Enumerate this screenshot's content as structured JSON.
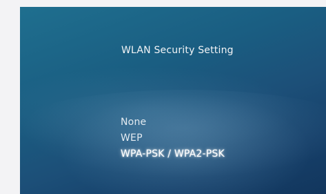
{
  "dialog": {
    "title": "WLAN Security Setting"
  },
  "options": [
    {
      "label": "None",
      "selected": false
    },
    {
      "label": "WEP",
      "selected": false
    },
    {
      "label": "WPA-PSK / WPA2-PSK",
      "selected": true
    }
  ],
  "colors": {
    "background_top": "#1f6f8f",
    "background_bottom": "#12365d",
    "text": "#f2f4f6",
    "page": "#f3f3f5"
  }
}
